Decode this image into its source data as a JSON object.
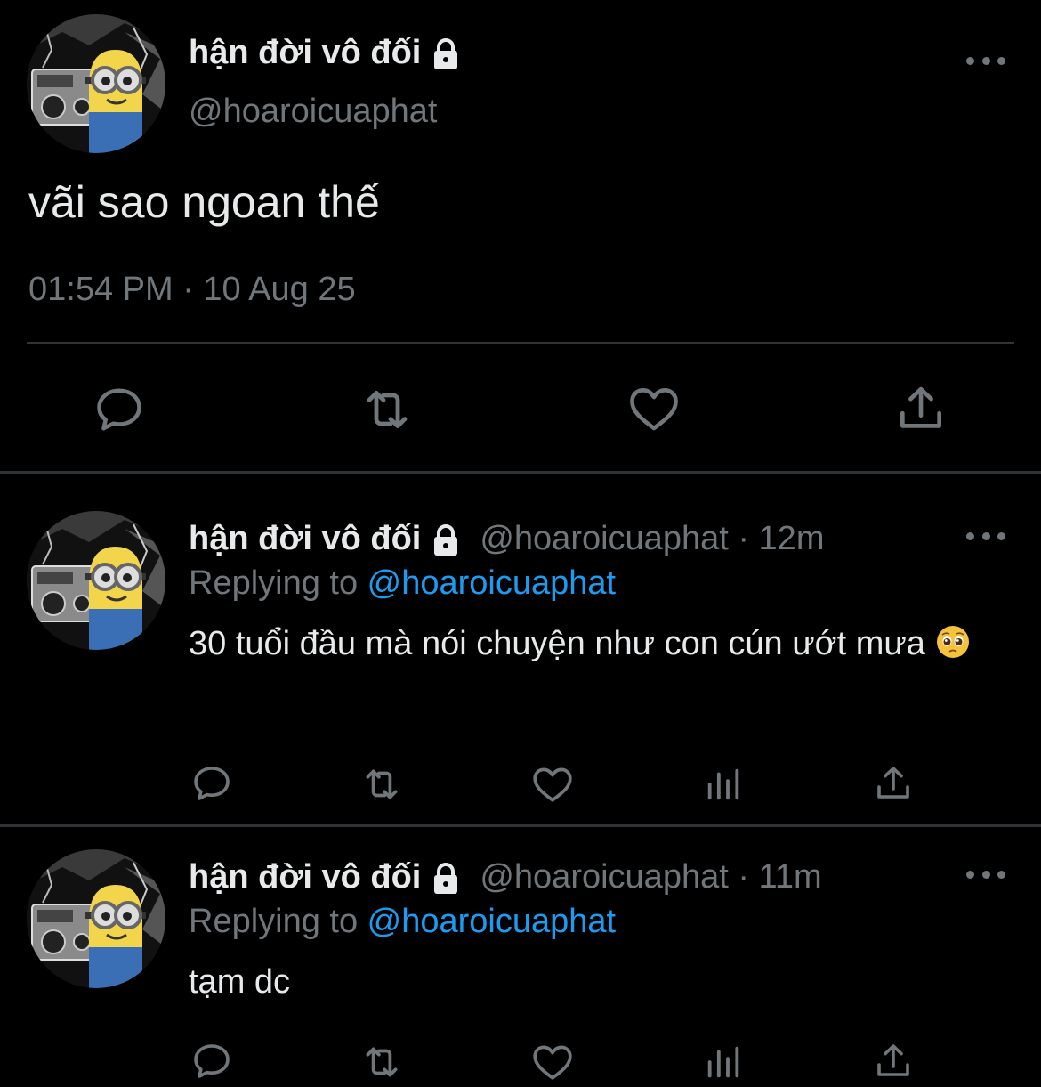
{
  "main_tweet": {
    "display_name": "hận đời vô đối",
    "handle": "@hoaroicuaphat",
    "text": "vãi sao ngoan thế",
    "timestamp": "01:54 PM · 10 Aug 25",
    "icons": {
      "lock": "lock-icon",
      "more": "more-icon",
      "reply": "reply-icon",
      "retweet": "retweet-icon",
      "like": "like-icon",
      "share": "share-icon"
    }
  },
  "replies": [
    {
      "display_name": "hận đời vô đối",
      "handle_time": "@hoaroicuaphat · 12m",
      "replying_prefix": "Replying to ",
      "replying_mention": "@hoaroicuaphat",
      "text": "30 tuổi đầu mà nói chuyện như con cún ướt mưa",
      "emoji": "pleading-face-emoji"
    },
    {
      "display_name": "hận đời vô đối",
      "handle_time": "@hoaroicuaphat · 11m",
      "replying_prefix": "Replying to ",
      "replying_mention": "@hoaroicuaphat",
      "text": "tạm dc"
    }
  ],
  "colors": {
    "background": "#000000",
    "text": "#e7e9ea",
    "muted": "#71767b",
    "accent": "#1d9bf0",
    "divider": "#2f3336"
  }
}
